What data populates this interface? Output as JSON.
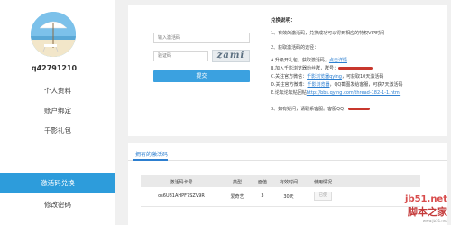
{
  "sidebar": {
    "username": "q42791210",
    "items": [
      {
        "label": "个人资料"
      },
      {
        "label": "账户绑定"
      },
      {
        "label": "千影礼包"
      },
      {
        "label": "激活码兑换"
      },
      {
        "label": "修改密码"
      }
    ],
    "active_index": 3
  },
  "redeem_form": {
    "code_placeholder": "输入激活码",
    "verify_placeholder": "验证码",
    "captcha_text": "zami",
    "submit_label": "提交"
  },
  "instructions": {
    "title": "兑换说明：",
    "line1": "1、有效的激活码，兑换成功可以得到相应的特权VIP时间",
    "line2": "2、获取激活码的途径：",
    "a_prefix": "A.升级开礼包，获取激活码，",
    "a_link": "点击详情",
    "b_prefix": "B.加入千影浏览器粉丝群，群号：",
    "c_prefix": "C.关注官方微信：",
    "c_link": "千影浏览器qying",
    "c_suffix": "，可获取10天激活码",
    "d_prefix": "D.关注官方微博：",
    "d_link": "千影浏览器",
    "d_suffix": "，QQ截图发给客服，可获7天激活码",
    "e_prefix": "E.论坛论坛帖回帖",
    "e_link": "http://bbs.qying.com/thread-182-1-1.html",
    "line3_prefix": "3、如有疑问，请联系客服。客服QQ："
  },
  "codes_table": {
    "tab_label": "拥有的激活码",
    "headers": [
      "激活码卡号",
      "类型",
      "面值",
      "有效时间",
      "使用情况"
    ],
    "rows": [
      {
        "code": "os6U81AHPF7SZV9R",
        "type": "爱奇艺",
        "value": "3",
        "duration": "30天",
        "status": "已使"
      }
    ]
  },
  "watermark": {
    "site": "jb51.net",
    "brand": "脚本之家",
    "url": "www.jb51.net"
  },
  "colors": {
    "accent": "#2d9cdb",
    "link": "#2d7fd0",
    "redact": "#c8372d"
  }
}
